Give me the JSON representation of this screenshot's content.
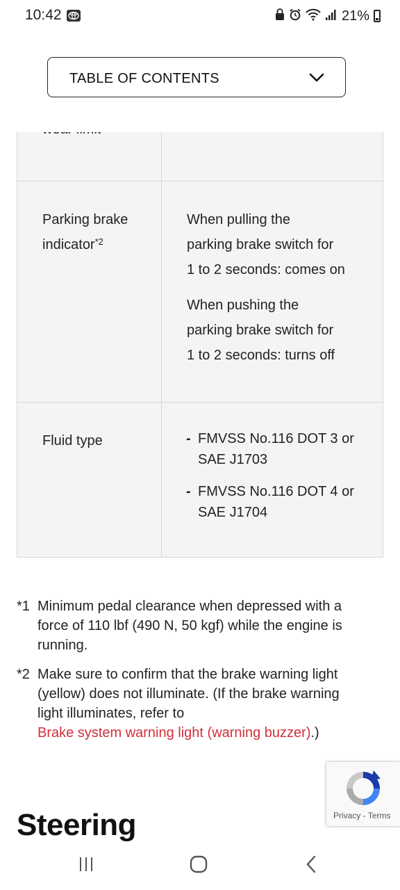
{
  "status_bar": {
    "time": "10:42",
    "battery": "21%",
    "icons": [
      "toyota-app-icon",
      "alarm-icon",
      "wifi-icon",
      "signal-icon",
      "battery-icon"
    ]
  },
  "toc": {
    "label": "TABLE OF CONTENTS",
    "icon": "chevron-down-icon"
  },
  "table": {
    "rows": [
      {
        "label": "wear limit",
        "value": ""
      },
      {
        "label": "Parking brake indicator",
        "label_sup": "*2",
        "value_paragraphs": [
          [
            "When pulling the",
            "parking brake switch for",
            "1 to 2 seconds: comes on"
          ],
          [
            "When pushing the",
            "parking brake switch for",
            "1 to 2 seconds: turns off"
          ]
        ]
      },
      {
        "label": "Fluid type",
        "value_items": [
          [
            "FMVSS No.116 DOT 3 or",
            "SAE J1703"
          ],
          [
            "FMVSS No.116 DOT 4 or",
            "SAE J1704"
          ]
        ]
      }
    ]
  },
  "footnotes": [
    {
      "mark": "*1",
      "lines": [
        "Minimum pedal clearance when depressed with a",
        "force of 110 lbf (490 N, 50 kgf) while the engine is",
        "running."
      ]
    },
    {
      "mark": "*2",
      "lines": [
        "Make sure to confirm that the brake warning light",
        "(yellow) does not illuminate. (If the brake warning",
        "light illuminates, refer to"
      ],
      "link": "Brake system warning light (warning buzzer)",
      "link_suffix": ".)"
    }
  ],
  "section_heading": "Steering",
  "recaptcha": {
    "privacy": "Privacy",
    "separator": " - ",
    "terms": "Terms"
  },
  "nav_bar": {
    "icons": [
      "recent-apps-icon",
      "home-icon",
      "back-icon"
    ]
  },
  "colors": {
    "link": "#d32f3a",
    "table_bg": "#f4f4f4",
    "border": "#d6d6d6"
  }
}
